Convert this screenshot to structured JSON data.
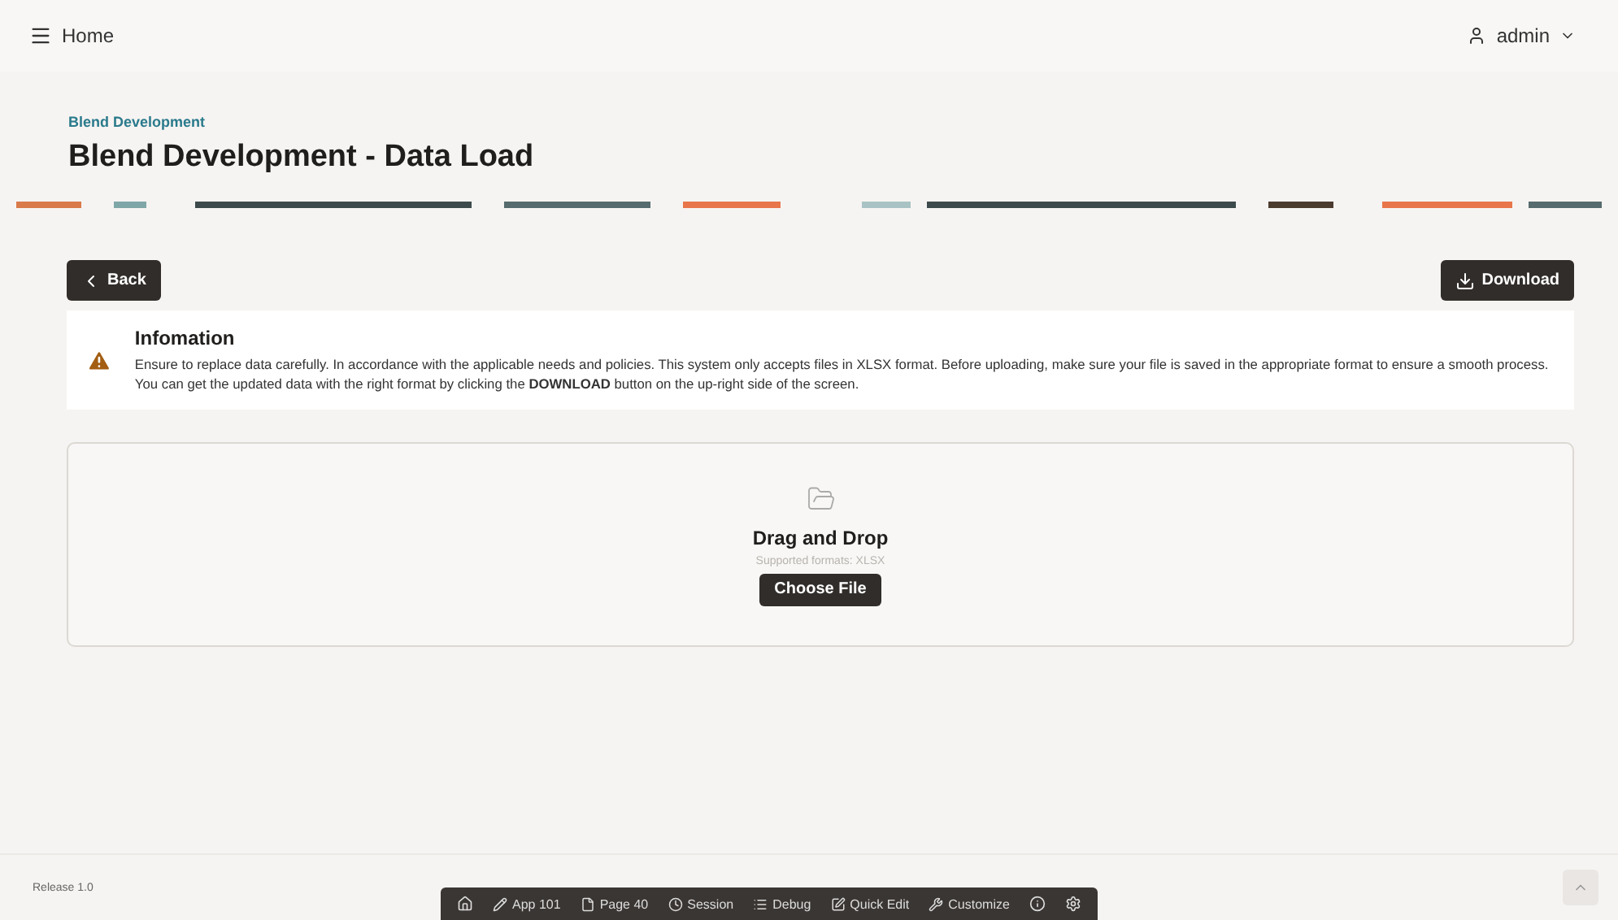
{
  "header": {
    "menu_label": "Home",
    "user": "admin"
  },
  "page": {
    "breadcrumb": "Blend Development",
    "title": "Blend Development - Data Load"
  },
  "actions": {
    "back": "Back",
    "download": "Download"
  },
  "alert": {
    "kind": "warning",
    "title": "Infomation",
    "text": "Ensure to replace data carefully. In accordance with the applicable needs and policies. This system only accepts files in XLSX format. Before uploading, make sure your file is saved in the appropriate format to ensure a smooth process. You can get the updated data with the right format by clicking the **DOWNLOAD** button on the up-right side of the screen."
  },
  "dropzone": {
    "title": "Drag and Drop",
    "hint": "Supported formats: XLSX",
    "button": "Choose File"
  },
  "footer": {
    "release": "Release 1.0"
  },
  "dev_toolbar": [
    {
      "kind": "home"
    },
    {
      "kind": "edit",
      "label": "App 101"
    },
    {
      "kind": "page",
      "label": "Page 40"
    },
    {
      "kind": "session",
      "label": "Session"
    },
    {
      "kind": "debug",
      "label": "Debug"
    },
    {
      "kind": "quick",
      "label": "Quick Edit"
    },
    {
      "kind": "customize",
      "label": "Customize"
    },
    {
      "kind": "info"
    },
    {
      "kind": "settings"
    }
  ]
}
